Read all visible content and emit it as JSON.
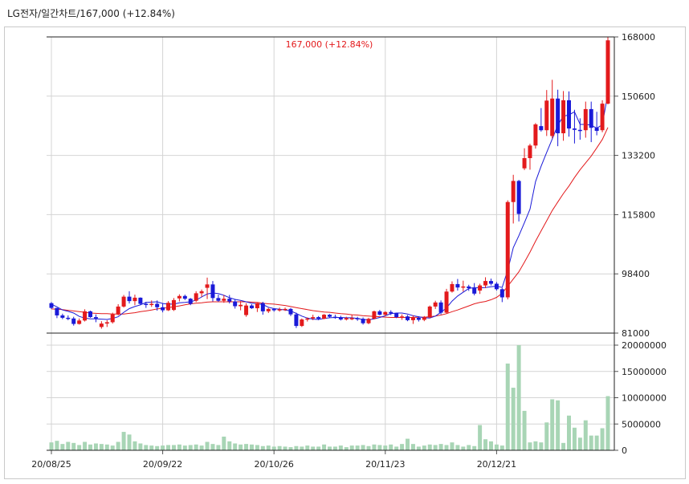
{
  "header": {
    "title": "LG전자/일간차트/167,000  (+12.84%)"
  },
  "chart_data": {
    "type": "candlestick",
    "annotation": "167,000 (+12.84%)",
    "y_ticks": [
      168000,
      150600,
      133200,
      115800,
      98400,
      81000
    ],
    "y_range": [
      81000,
      168000
    ],
    "volume_ticks": [
      20000000,
      15000000,
      10000000,
      5000000,
      0
    ],
    "volume_range": [
      0,
      20000000
    ],
    "x_ticks": [
      "20/08/25",
      "20/09/22",
      "20/10/26",
      "20/11/23",
      "20/12/21"
    ],
    "x_tick_index": [
      0,
      20,
      40,
      60,
      80
    ],
    "colors": {
      "up": "#e31a1c",
      "down": "#1a1ad8",
      "ma5": "#1a1ad8",
      "ma20": "#e31a1c",
      "volume": "#a8d5b5",
      "annotation": "#e31a1c"
    },
    "candles": [
      [
        89800,
        90100,
        88100,
        88400
      ],
      [
        88400,
        88400,
        85400,
        86200
      ],
      [
        86200,
        86700,
        85100,
        85500
      ],
      [
        85500,
        86200,
        84800,
        85300
      ],
      [
        85300,
        85800,
        83200,
        83700
      ],
      [
        83700,
        85300,
        83500,
        84700
      ],
      [
        84700,
        88000,
        84400,
        87400
      ],
      [
        87400,
        87600,
        85500,
        85700
      ],
      [
        85700,
        86500,
        84200,
        85300
      ],
      [
        82800,
        84500,
        82300,
        83800
      ],
      [
        83800,
        84800,
        82800,
        84200
      ],
      [
        84200,
        87000,
        83800,
        86500
      ],
      [
        86500,
        89500,
        86200,
        88800
      ],
      [
        88800,
        92200,
        88500,
        91700
      ],
      [
        91700,
        93300,
        89700,
        90400
      ],
      [
        90400,
        92300,
        89200,
        91400
      ],
      [
        91400,
        91500,
        89200,
        89600
      ],
      [
        89600,
        90200,
        88400,
        89300
      ],
      [
        89300,
        90600,
        88700,
        89600
      ],
      [
        89600,
        90600,
        87600,
        88600
      ],
      [
        88600,
        89800,
        87100,
        87700
      ],
      [
        87700,
        90400,
        87500,
        89900
      ],
      [
        87800,
        91300,
        87500,
        90700
      ],
      [
        91200,
        92400,
        90300,
        91900
      ],
      [
        91900,
        92300,
        90700,
        91100
      ],
      [
        91100,
        91300,
        89200,
        89600
      ],
      [
        90500,
        93300,
        90100,
        92700
      ],
      [
        92700,
        93800,
        91600,
        93300
      ],
      [
        94300,
        97300,
        91000,
        95300
      ],
      [
        95300,
        96300,
        90300,
        91300
      ],
      [
        91300,
        92300,
        90200,
        90500
      ],
      [
        90500,
        92200,
        89900,
        91100
      ],
      [
        91100,
        92200,
        89700,
        90300
      ],
      [
        90300,
        91000,
        88200,
        88900
      ],
      [
        88900,
        90400,
        87700,
        89300
      ],
      [
        86300,
        89800,
        85800,
        89100
      ],
      [
        89100,
        89500,
        88100,
        88300
      ],
      [
        88300,
        89900,
        87200,
        89800
      ],
      [
        89800,
        90200,
        86400,
        87400
      ],
      [
        87400,
        88400,
        86900,
        88100
      ],
      [
        88100,
        88300,
        87300,
        87700
      ],
      [
        87700,
        88500,
        87300,
        88000
      ],
      [
        88000,
        88500,
        87500,
        88100
      ],
      [
        88100,
        88400,
        86000,
        86500
      ],
      [
        86500,
        87000,
        82500,
        83100
      ],
      [
        83100,
        85300,
        82800,
        85000
      ],
      [
        85000,
        85600,
        84400,
        85300
      ],
      [
        85300,
        86400,
        84800,
        85700
      ],
      [
        85700,
        86000,
        84800,
        85200
      ],
      [
        85200,
        86600,
        85100,
        86400
      ],
      [
        86400,
        86600,
        85500,
        85800
      ],
      [
        85800,
        86400,
        85200,
        85600
      ],
      [
        85600,
        86100,
        84700,
        85000
      ],
      [
        85000,
        85800,
        84700,
        85400
      ],
      [
        85400,
        86400,
        84800,
        85400
      ],
      [
        85400,
        85800,
        84600,
        85200
      ],
      [
        85200,
        85600,
        83500,
        83900
      ],
      [
        83900,
        85500,
        83600,
        85200
      ],
      [
        85200,
        87600,
        85100,
        87400
      ],
      [
        87400,
        87800,
        86200,
        86400
      ],
      [
        86400,
        87400,
        86000,
        87200
      ],
      [
        87200,
        87700,
        86300,
        86800
      ],
      [
        86800,
        87000,
        85400,
        85700
      ],
      [
        85700,
        86500,
        84900,
        85900
      ],
      [
        85900,
        86300,
        84500,
        84800
      ],
      [
        84800,
        86200,
        83700,
        85500
      ],
      [
        85500,
        85900,
        84400,
        84900
      ],
      [
        84900,
        86000,
        84500,
        85600
      ],
      [
        85600,
        89100,
        85400,
        88800
      ],
      [
        88800,
        90500,
        88100,
        90000
      ],
      [
        90000,
        90600,
        86500,
        87000
      ],
      [
        87000,
        94000,
        86800,
        93200
      ],
      [
        93200,
        96200,
        92900,
        95400
      ],
      [
        95400,
        96900,
        93500,
        94400
      ],
      [
        94400,
        96400,
        93200,
        94700
      ],
      [
        94700,
        95200,
        93400,
        94200
      ],
      [
        94200,
        95700,
        92100,
        92600
      ],
      [
        93500,
        95500,
        92500,
        95000
      ],
      [
        95000,
        97400,
        94200,
        96300
      ],
      [
        96300,
        97000,
        95000,
        95500
      ],
      [
        95500,
        96000,
        93500,
        93900
      ],
      [
        93900,
        94200,
        90100,
        91500
      ],
      [
        91500,
        120000,
        90900,
        119500
      ],
      [
        119500,
        127500,
        113200,
        125700
      ],
      [
        125700,
        126000,
        113800,
        116000
      ],
      [
        129400,
        135300,
        128900,
        132400
      ],
      [
        132400,
        136600,
        129000,
        136100
      ],
      [
        136100,
        142700,
        135200,
        142300
      ],
      [
        141800,
        147100,
        140200,
        140600
      ],
      [
        140600,
        152400,
        138900,
        149300
      ],
      [
        138900,
        155400,
        138200,
        149900
      ],
      [
        149900,
        152500,
        135900,
        139700
      ],
      [
        139700,
        152100,
        137500,
        149400
      ],
      [
        149400,
        152000,
        138700,
        141100
      ],
      [
        141100,
        146600,
        136700,
        140700
      ],
      [
        140700,
        144100,
        137800,
        140600
      ],
      [
        140600,
        149000,
        138400,
        146800
      ],
      [
        146800,
        149000,
        137100,
        141300
      ],
      [
        141300,
        146000,
        139100,
        140400
      ],
      [
        140600,
        149400,
        140000,
        148400
      ],
      [
        148400,
        168000,
        148200,
        167000
      ]
    ],
    "ma5": [
      89500,
      88700,
      87800,
      87400,
      86900,
      85900,
      85400,
      85200,
      85200,
      85100,
      85000,
      85300,
      85800,
      87100,
      88200,
      88800,
      89300,
      90000,
      90100,
      90200,
      89700,
      89500,
      89500,
      89900,
      90000,
      90200,
      90700,
      91600,
      92500,
      92800,
      92600,
      92100,
      91400,
      90900,
      90600,
      90200,
      89800,
      89600,
      89400,
      88600,
      88200,
      88000,
      87800,
      87500,
      86800,
      86000,
      85400,
      85100,
      85000,
      85300,
      85500,
      85600,
      85600,
      85500,
      85500,
      85300,
      85000,
      84900,
      85200,
      85600,
      86100,
      86700,
      86900,
      86900,
      86600,
      86100,
      85800,
      85500,
      85400,
      86000,
      87100,
      88400,
      90400,
      91900,
      93000,
      94100,
      94400,
      94300,
      94400,
      94600,
      94800,
      94400,
      99500,
      106100,
      109600,
      113400,
      117400,
      125500,
      130000,
      134100,
      138000,
      142100,
      144700,
      145100,
      146000,
      142300,
      142300,
      142100,
      141200,
      142200,
      151500
    ],
    "ma20": [
      88100,
      88000,
      87900,
      87700,
      87500,
      87300,
      87100,
      86900,
      86800,
      86700,
      86700,
      86600,
      86600,
      86600,
      86800,
      87000,
      87300,
      87500,
      87800,
      88100,
      88300,
      88500,
      88700,
      89000,
      89300,
      89600,
      89800,
      89900,
      90100,
      90200,
      90200,
      90200,
      90200,
      90200,
      90200,
      90200,
      90100,
      90000,
      89800,
      89600,
      89500,
      89300,
      89100,
      88800,
      88500,
      88200,
      87900,
      87600,
      87400,
      87200,
      87100,
      86900,
      86700,
      86600,
      86400,
      86300,
      86100,
      86000,
      85900,
      85800,
      85700,
      85600,
      85600,
      85600,
      85600,
      85600,
      85700,
      85700,
      85800,
      86000,
      86300,
      86700,
      87300,
      87800,
      88400,
      89000,
      89600,
      90000,
      90300,
      90800,
      91500,
      92700,
      94800,
      96900,
      99000,
      101800,
      104800,
      108000,
      111000,
      114000,
      117000,
      119500,
      122000,
      124200,
      126700,
      129000,
      131000,
      133000,
      135400,
      137900,
      141400
    ],
    "volume": [
      1500000,
      1800000,
      1200000,
      1600000,
      1400000,
      1000000,
      1600000,
      1100000,
      1300000,
      1200000,
      1100000,
      900000,
      1600000,
      3500000,
      3000000,
      1700000,
      1300000,
      1000000,
      900000,
      800000,
      900000,
      1000000,
      1000000,
      1100000,
      900000,
      1000000,
      1100000,
      900000,
      1600000,
      1200000,
      1000000,
      2600000,
      1700000,
      1300000,
      1100000,
      1200000,
      1100000,
      1000000,
      800000,
      900000,
      700000,
      800000,
      700000,
      600000,
      800000,
      700000,
      900000,
      700000,
      700000,
      1100000,
      700000,
      700000,
      900000,
      600000,
      900000,
      900000,
      1000000,
      800000,
      1100000,
      1000000,
      900000,
      1100000,
      700000,
      1200000,
      2200000,
      1200000,
      700000,
      900000,
      1100000,
      1000000,
      1200000,
      1000000,
      1500000,
      1000000,
      700000,
      1000000,
      800000,
      4800000,
      2100000,
      1700000,
      1100000,
      900000,
      16500000,
      11900000,
      20000000,
      7500000,
      1500000,
      1700000,
      1500000,
      5300000,
      9700000,
      9500000,
      1400000,
      6600000,
      4300000,
      2400000,
      5700000,
      2800000,
      2800000,
      4200000,
      10300000
    ]
  }
}
